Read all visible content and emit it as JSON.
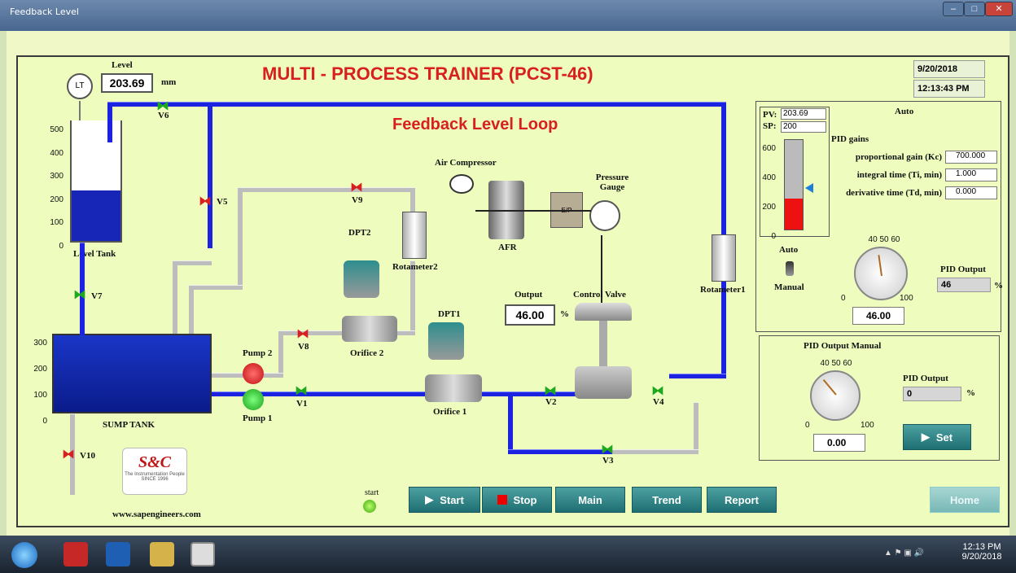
{
  "window": {
    "title": "Feedback Level"
  },
  "header": {
    "title": "MULTI - PROCESS TRAINER (PCST-46)",
    "subtitle": "Feedback Level Loop",
    "date": "9/20/2018",
    "time": "12:13:43 PM"
  },
  "level": {
    "label": "Level",
    "value": "203.69",
    "unit": "mm",
    "lt": "LT"
  },
  "tank": {
    "label": "Level Tank",
    "scale": [
      "500",
      "400",
      "300",
      "200",
      "100",
      "0"
    ],
    "fill_fraction": 0.41
  },
  "sump": {
    "label": "SUMP TANK",
    "scale": [
      "300",
      "200",
      "100",
      "0"
    ]
  },
  "valves": {
    "v1": "V1",
    "v2": "V2",
    "v3": "V3",
    "v4": "V4",
    "v5": "V5",
    "v6": "V6",
    "v7": "V7",
    "v8": "V8",
    "v9": "V9",
    "v10": "V10"
  },
  "pumps": {
    "pump1": "Pump 1",
    "pump2": "Pump 2"
  },
  "equipment": {
    "air_compressor": "Air Compressor",
    "afr": "AFR",
    "ep": "E/P",
    "pressure_gauge": "Pressure Gauge",
    "control_valve": "Control Valve",
    "dpt1": "DPT1",
    "dpt2": "DPT2",
    "orifice1": "Orifice 1",
    "orifice2": "Orifice 2",
    "rotameter1": "Rotameter1",
    "rotameter2": "Rotameter2"
  },
  "output": {
    "label": "Output",
    "value": "46.00",
    "unit": "%"
  },
  "control_panel": {
    "pv_label": "PV:",
    "pv_value": "203.69",
    "sp_label": "SP:",
    "sp_value": "200",
    "bar_scale": [
      "600",
      "400",
      "200",
      "0"
    ],
    "bar_fill_fraction": 0.34,
    "mode_title": "Auto",
    "pid_gains_title": "PID gains",
    "kc_label": "proportional gain (Kc)",
    "kc_value": "700.000",
    "ti_label": "integral time (Ti, min)",
    "ti_value": "1.000",
    "td_label": "derivative time (Td, min)",
    "td_value": "0.000",
    "switch_auto": "Auto",
    "switch_manual": "Manual",
    "knob_ticks": [
      "0",
      "10",
      "20",
      "30",
      "40",
      "50",
      "60",
      "70",
      "80",
      "90",
      "100"
    ],
    "knob_value": "46.00",
    "pid_output_label": "PID Output",
    "pid_output_value": "46",
    "pid_output_unit": "%"
  },
  "manual_panel": {
    "title": "PID Output Manual",
    "knob_ticks": [
      "0",
      "10",
      "20",
      "30",
      "40",
      "50",
      "60",
      "70",
      "80",
      "90",
      "100"
    ],
    "knob_value": "0.00",
    "pid_output_label": "PID Output",
    "pid_output_value": "0",
    "pid_output_unit": "%",
    "set_label": "Set"
  },
  "footer": {
    "start_indicator": "start",
    "start": "Start",
    "stop": "Stop",
    "main": "Main",
    "trend": "Trend",
    "report": "Report",
    "home": "Home",
    "website": "www.sapengineers.com",
    "logo_text": "S&C",
    "logo_tagline": "The Instrumentation People SINCE 1996"
  },
  "taskbar": {
    "time": "12:13 PM",
    "date": "9/20/2018"
  },
  "colors": {
    "pipe_blue": "#1b22e0",
    "pipe_grey": "#bdbdbd",
    "title_red": "#d8201e",
    "panel_bg": "#eefcbe",
    "button_teal": "#2a8486"
  }
}
